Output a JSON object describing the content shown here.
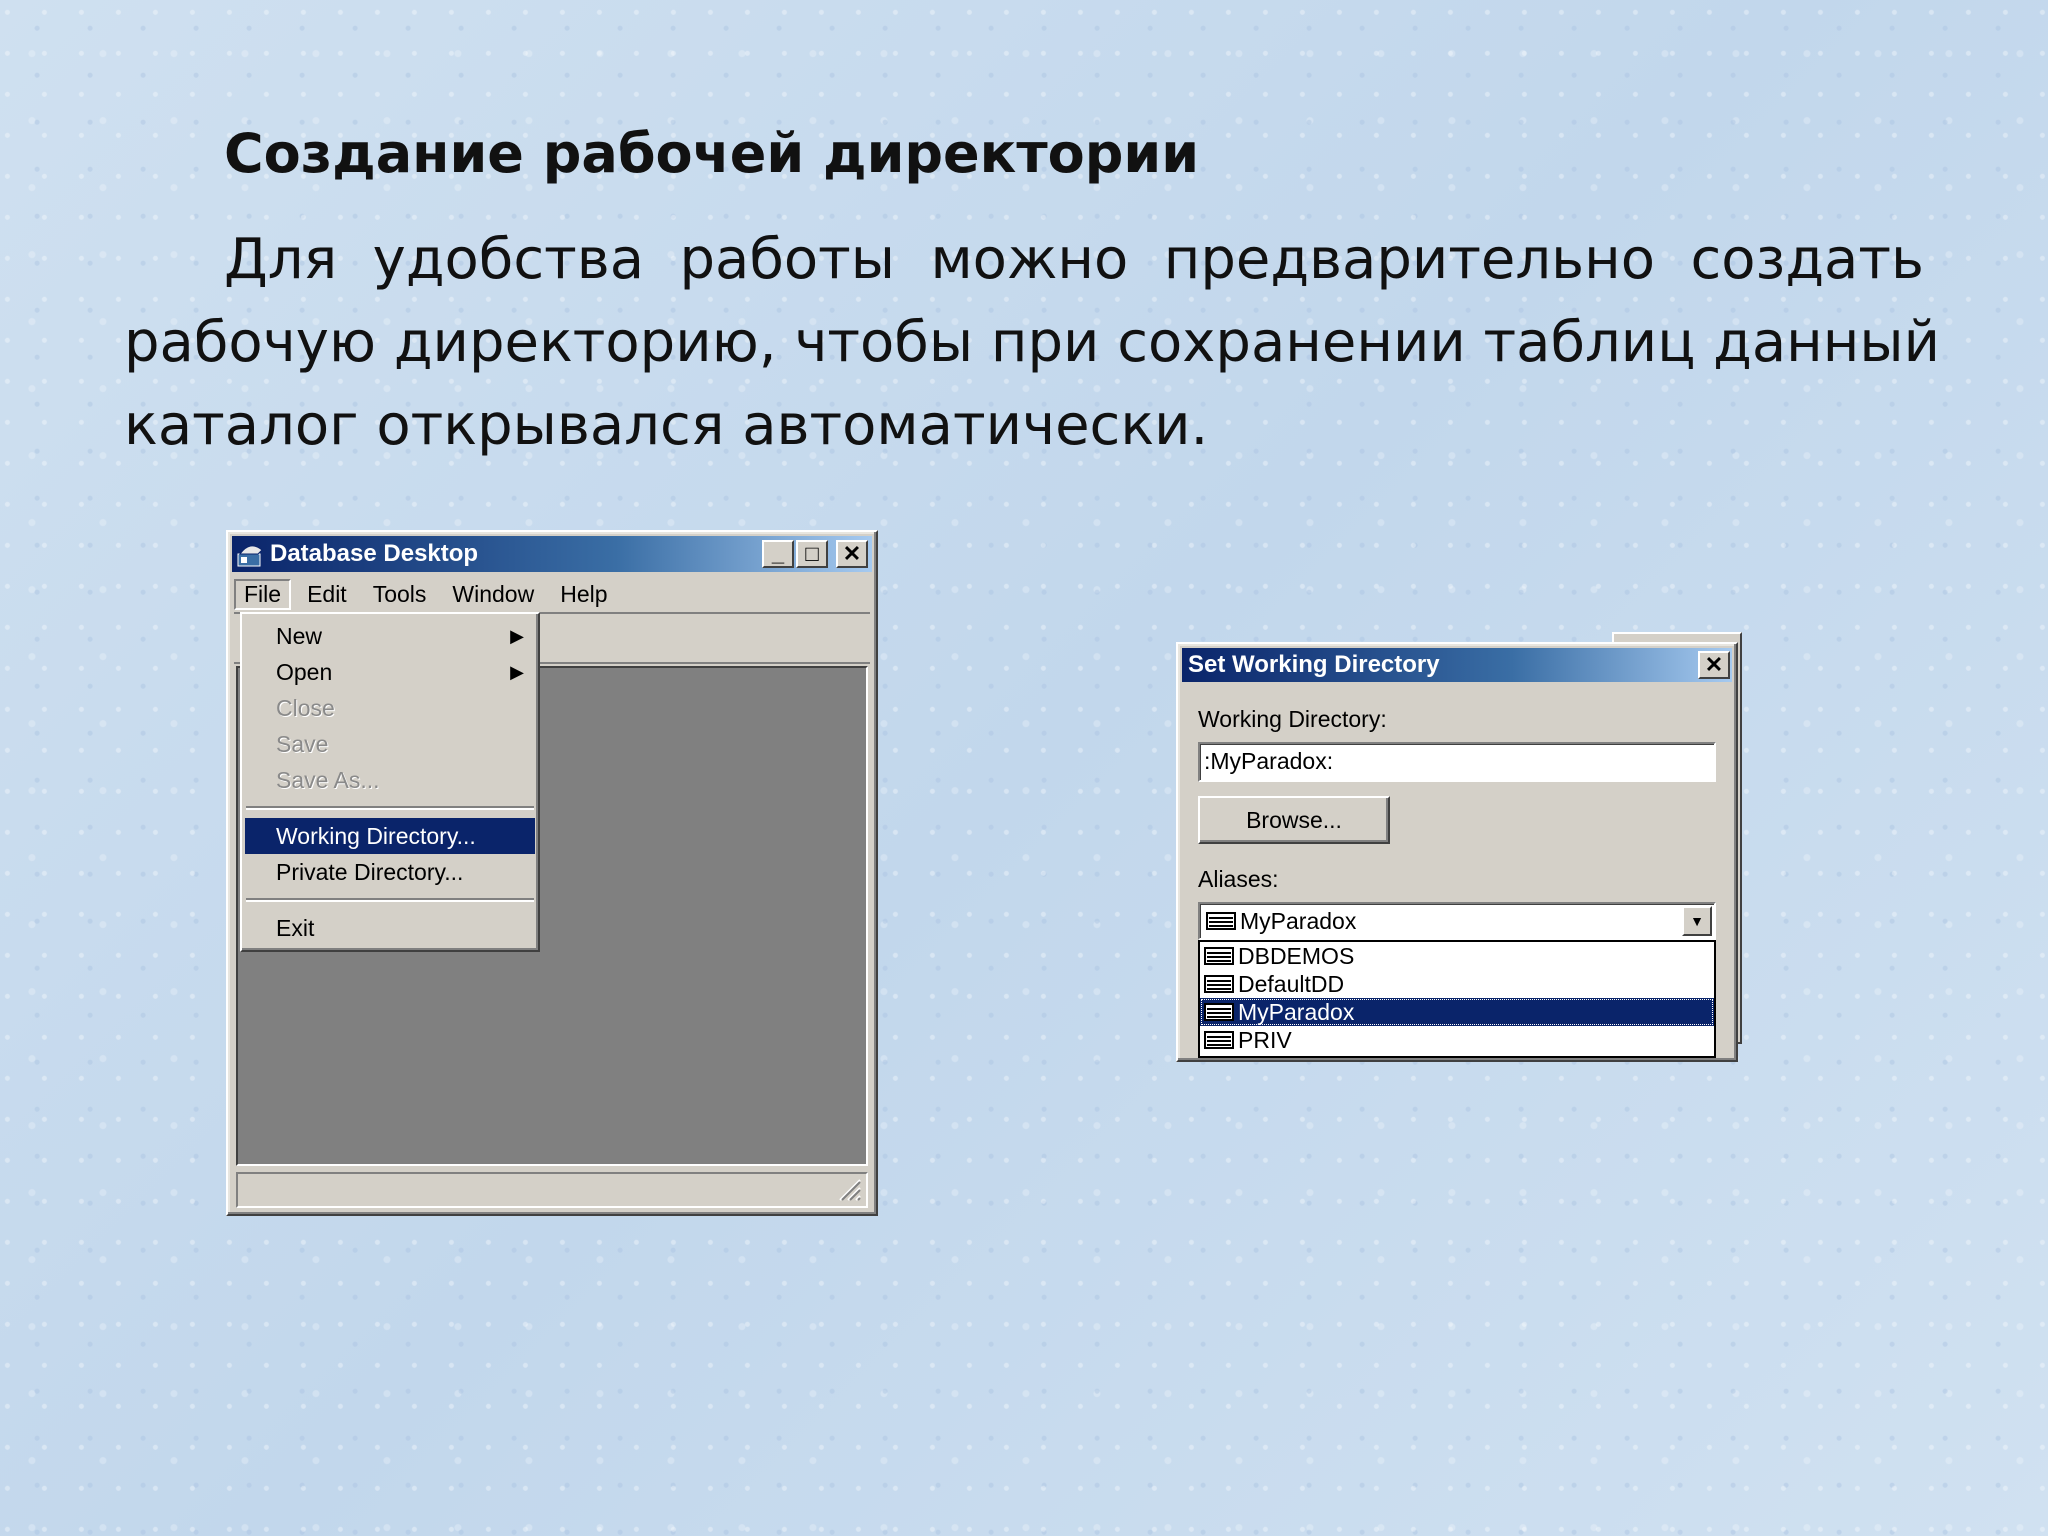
{
  "slide": {
    "title": "Создание рабочей директории",
    "body_lines": [
      [
        "Для",
        "удобства",
        "работы",
        "можно",
        "предварительно",
        "создать"
      ],
      "рабочую директорию, чтобы при сохранении таблиц данный",
      "каталог открывался автоматически."
    ]
  },
  "database_desktop": {
    "title": "Database Desktop",
    "title_buttons": {
      "minimize": "_",
      "maximize": "□",
      "close": "✕"
    },
    "menu": [
      "File",
      "Edit",
      "Tools",
      "Window",
      "Help"
    ],
    "file_menu": {
      "items": [
        {
          "label": "New",
          "submenu": true
        },
        {
          "label": "Open",
          "submenu": true
        },
        {
          "label": "Close",
          "disabled": true
        },
        {
          "label": "Save",
          "disabled": true
        },
        {
          "label": "Save As...",
          "disabled": true
        },
        {
          "label": "Working Directory...",
          "selected": true
        },
        {
          "label": "Private Directory..."
        },
        {
          "label": "Exit"
        }
      ],
      "submenu_arrow": "▶"
    }
  },
  "dialog": {
    "title": "Set Working Directory",
    "close": "✕",
    "working_directory_label": "Working Directory:",
    "working_directory_value": ":MyParadox:",
    "browse_label": "Browse...",
    "aliases_label": "Aliases:",
    "aliases_selected": "MyParadox",
    "aliases_options": [
      "DBDEMOS",
      "DefaultDD",
      "MyParadox",
      "PRIV"
    ],
    "aliases_highlighted": "MyParadox",
    "combo_arrow": "▼"
  },
  "colors": {
    "titlebar_start": "#0a246a",
    "titlebar_end": "#a6caf0",
    "window_face": "#d4d0c8",
    "client_area": "#808080",
    "selection": "#0a246a"
  }
}
